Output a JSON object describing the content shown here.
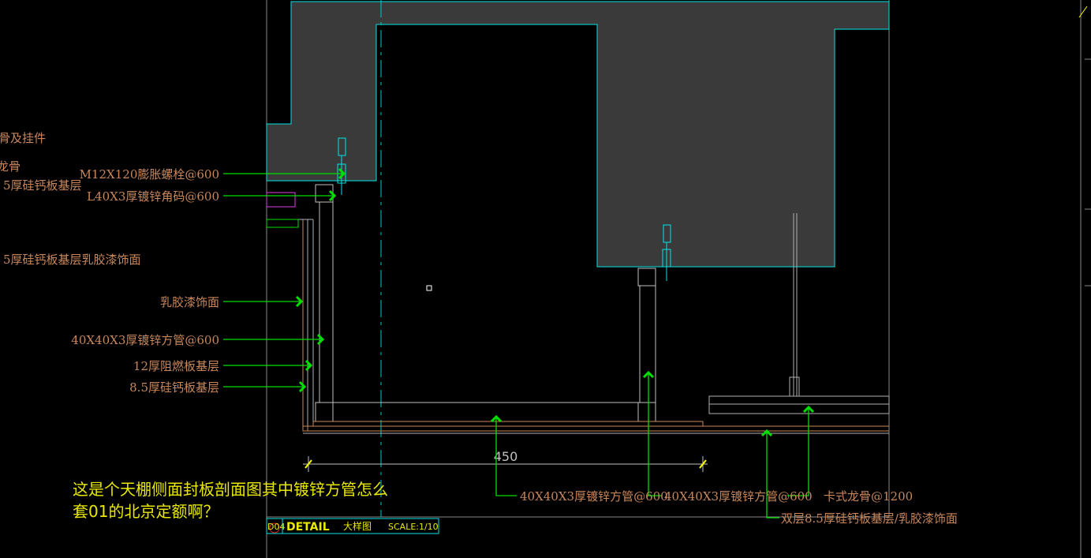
{
  "left_labels": [
    "骨及挂件",
    "龙骨",
    "5厚硅钙板基层",
    "5厚硅钙板基层乳胶漆饰面"
  ],
  "callouts": [
    "M12X120膨胀螺栓@600",
    "L40X3厚镀锌角码@600",
    "乳胶漆饰面",
    "40X40X3厚镀锌方管@600",
    "12厚阻燃板基层",
    "8.5厚硅钙板基层"
  ],
  "bottom_callouts": [
    "40X40X3厚镀锌方管@600",
    "40X40X3厚镀锌方管@600",
    "卡式龙骨@1200",
    "双层8.5厚硅钙板基层/乳胶漆饰面"
  ],
  "dimension": "450",
  "title_block": {
    "number": "D04",
    "title": "DETAIL",
    "subtitle": "大样图",
    "scale": "SCALE:1/10"
  },
  "note": {
    "line1": "这是个天棚侧面封板剖面图其中镀锌方管怎么",
    "line2": "套01的北京定额啊？"
  },
  "colors": {
    "background": "#000000",
    "leader": "#00e000",
    "label": "#c8875a",
    "outline": "#00e5e5",
    "concrete": "#3a3a3a",
    "note": "#e8e800"
  }
}
